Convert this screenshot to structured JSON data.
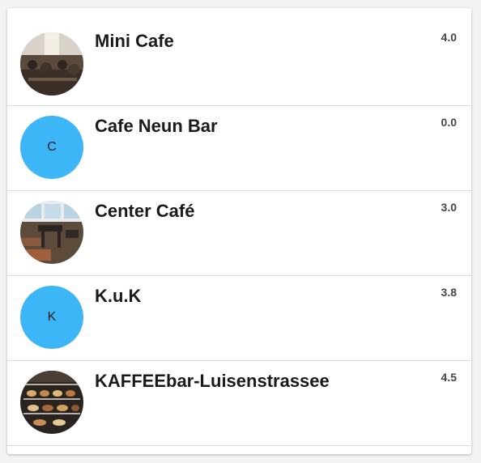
{
  "colors": {
    "accent": "#3db6f7",
    "card_bg": "#ffffff",
    "page_bg": "#f3f3f3"
  },
  "places": [
    {
      "name": "Mini Cafe",
      "rating": "4.0",
      "avatar_type": "photo",
      "avatar_icon": "cafe-terrace-photo"
    },
    {
      "name": "Cafe Neun Bar",
      "rating": "0.0",
      "avatar_type": "letter",
      "avatar_letter": "C"
    },
    {
      "name": "Center Café",
      "rating": "3.0",
      "avatar_type": "photo",
      "avatar_icon": "cafe-interior-photo"
    },
    {
      "name": "K.u.K",
      "rating": "3.8",
      "avatar_type": "letter",
      "avatar_letter": "K"
    },
    {
      "name": "KAFFEEbar-Luisenstrassee",
      "rating": "4.5",
      "avatar_type": "photo",
      "avatar_icon": "pastry-display-photo"
    }
  ]
}
